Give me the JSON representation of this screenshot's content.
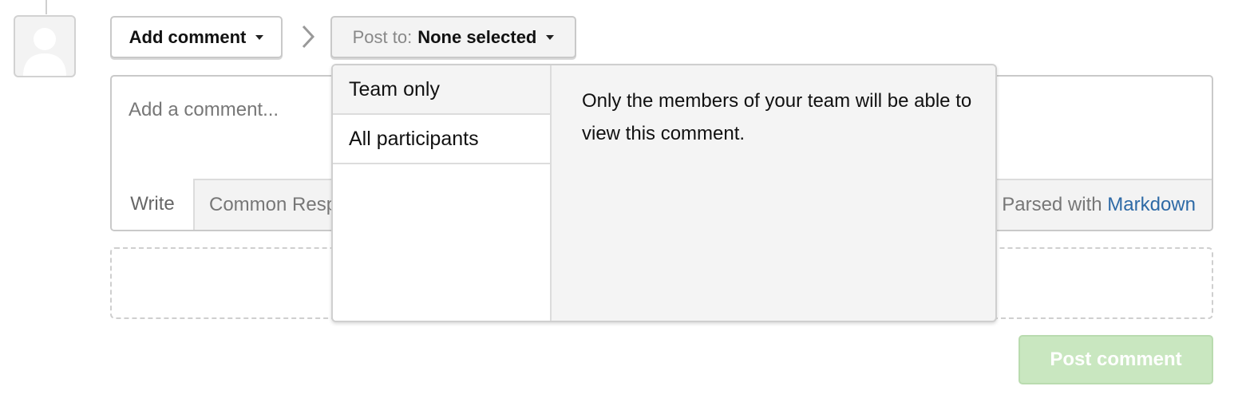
{
  "toolbar": {
    "add_comment_label": "Add comment",
    "post_to_label": "Post to:",
    "post_to_value": "None selected"
  },
  "editor": {
    "placeholder": "Add a comment...",
    "tab_write": "Write",
    "tab_common_responses": "Common Resp",
    "parsed_with": "Parsed with",
    "markdown_link": "Markdown"
  },
  "dropdown": {
    "options": [
      "Team only",
      "All participants"
    ],
    "selected_index": 0,
    "description": "Only the members of your team will be able to view this comment."
  },
  "post_comment_label": "Post comment",
  "icons": {
    "avatar": "user-silhouette-icon",
    "chevron": "chevron-right-icon",
    "caret": "caret-down-icon"
  },
  "colors": {
    "post_button_bg": "#c9e7c0",
    "link": "#2e6aa6"
  }
}
